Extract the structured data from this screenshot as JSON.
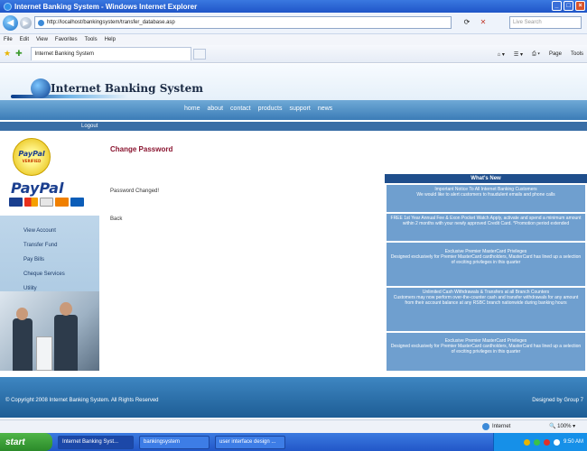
{
  "window": {
    "title": "Internet Banking System - Windows Internet Explorer"
  },
  "navbar": {
    "url": "http://localhost/bankingsystem/transfer_database.asp",
    "search_placeholder": "Live Search"
  },
  "menu": [
    "File",
    "Edit",
    "View",
    "Favorites",
    "Tools",
    "Help"
  ],
  "tab": {
    "label": "Internet Banking System"
  },
  "commands": {
    "page": "Page",
    "tools": "Tools"
  },
  "site": {
    "logo_text": "Internet Banking System",
    "nav": [
      "home",
      "about",
      "contact",
      "products",
      "support",
      "news"
    ],
    "logout": "Logout",
    "paypal_seal": "PayPal",
    "paypal_seal_sub": "VERIFIED",
    "paypal_logo": "PayPal",
    "sidebar_menu": [
      "View Account",
      "Transfer Fund",
      "Pay Bills",
      "Cheque Services",
      "Utility"
    ],
    "page_title": "Change Password",
    "message": "Password Changed!",
    "back_link": "Back",
    "whats_new_title": "What's New",
    "news": [
      "Important Notice To All Internet Banking Customers\nWe would like to alert customers to fraudulent emails and phone calls",
      "FREE 1st Year Annual Fee & Exon Pocket Watch Apply, activate and spend a minimum amount within 2 months with your newly approved Credit Card. *Promotion period extended",
      "Exclusive Premier MasterCard Privileges\nDesigned exclusively for Premier MasterCard cardholders, MasterCard has lined up a selection of exciting privileges in this quarter",
      "Unlimited Cash Withdrawals & Transfers at all Branch Counters\nCustomers may now perform over-the-counter cash and transfer withdrawals for any amount from their account balance at any RSBC branch nationwide during banking hours",
      "Exclusive Premier MasterCard Privileges\nDesigned exclusively for Premier MasterCard cardholders, MasterCard has lined up a selection of exciting privileges in this quarter"
    ],
    "copyright": "© Copyright 2008 Internet Banking System. All Rights Reserved",
    "designed_by": "Designed by Group 7"
  },
  "status": {
    "zone": "Internet",
    "zoom": "100%"
  },
  "taskbar": {
    "start": "start",
    "tasks": [
      "Internet Banking Syst...",
      "bankingsystem",
      "user interface design ..."
    ],
    "clock": "9:50 AM"
  }
}
